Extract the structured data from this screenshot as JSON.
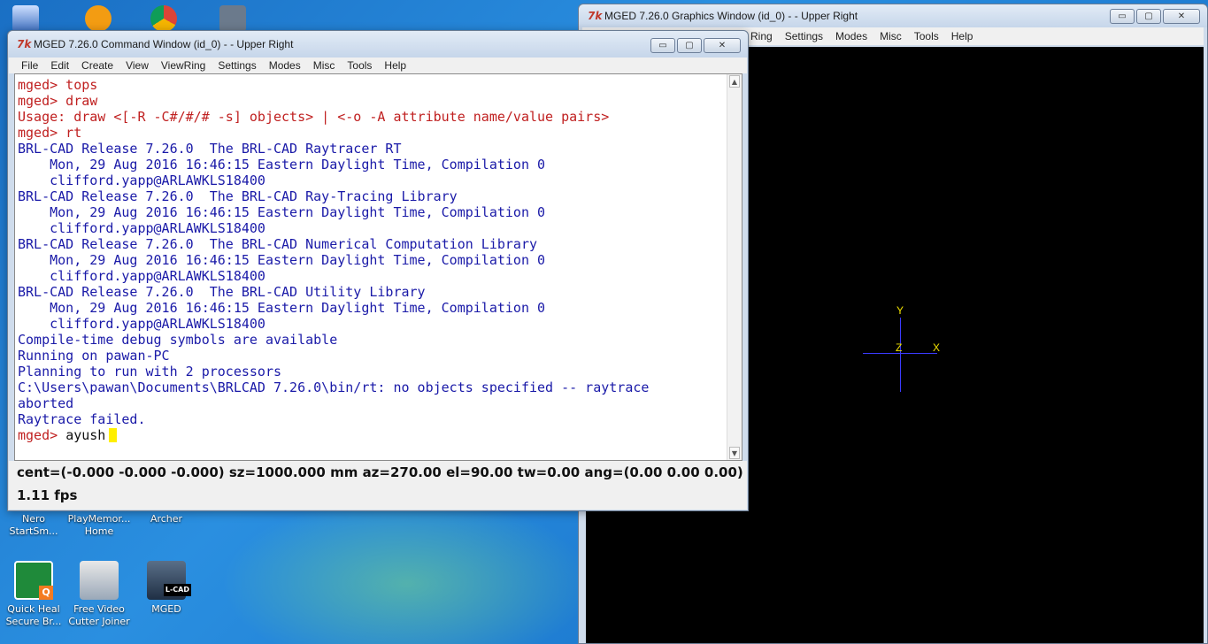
{
  "desktop": {
    "icons_top": [
      {
        "label": "Nero StartSm..."
      },
      {
        "label": "PlayMemor... Home"
      },
      {
        "label": "Archer"
      }
    ],
    "icons": [
      {
        "label_1": "Quick Heal",
        "label_2": "Secure Br...",
        "icon": "quickheal-icon"
      },
      {
        "label_1": "Free Video",
        "label_2": "Cutter Joiner",
        "icon": "video-cutter-icon"
      },
      {
        "label_1": "MGED",
        "label_2": "",
        "icon": "mged-icon"
      }
    ]
  },
  "graphics_window": {
    "title": "MGED 7.26.0 Graphics Window (id_0) -  - Upper Right",
    "menu": [
      "Ring",
      "Settings",
      "Modes",
      "Misc",
      "Tools",
      "Help"
    ],
    "axis_labels": {
      "x": "X",
      "y": "Y",
      "z": "Z"
    },
    "background": "#000000"
  },
  "command_window": {
    "title": "MGED 7.26.0 Command Window (id_0) -  - Upper Right",
    "menu": [
      "File",
      "Edit",
      "Create",
      "View",
      "ViewRing",
      "Settings",
      "Modes",
      "Misc",
      "Tools",
      "Help"
    ],
    "console": [
      {
        "type": "prompt",
        "text": "mged> tops"
      },
      {
        "type": "prompt",
        "text": "mged> draw"
      },
      {
        "type": "err",
        "text": "Usage: draw <[-R -C#/#/# -s] objects> | <-o -A attribute name/value pairs>"
      },
      {
        "type": "prompt",
        "text": "mged> rt"
      },
      {
        "type": "out",
        "text": "BRL-CAD Release 7.26.0  The BRL-CAD Raytracer RT"
      },
      {
        "type": "out",
        "text": "    Mon, 29 Aug 2016 16:46:15 Eastern Daylight Time, Compilation 0"
      },
      {
        "type": "out",
        "text": "    clifford.yapp@ARLAWKLS18400"
      },
      {
        "type": "out",
        "text": "BRL-CAD Release 7.26.0  The BRL-CAD Ray-Tracing Library"
      },
      {
        "type": "out",
        "text": "    Mon, 29 Aug 2016 16:46:15 Eastern Daylight Time, Compilation 0"
      },
      {
        "type": "out",
        "text": "    clifford.yapp@ARLAWKLS18400"
      },
      {
        "type": "out",
        "text": "BRL-CAD Release 7.26.0  The BRL-CAD Numerical Computation Library"
      },
      {
        "type": "out",
        "text": "    Mon, 29 Aug 2016 16:46:15 Eastern Daylight Time, Compilation 0"
      },
      {
        "type": "out",
        "text": "    clifford.yapp@ARLAWKLS18400"
      },
      {
        "type": "out",
        "text": "BRL-CAD Release 7.26.0  The BRL-CAD Utility Library"
      },
      {
        "type": "out",
        "text": "    Mon, 29 Aug 2016 16:46:15 Eastern Daylight Time, Compilation 0"
      },
      {
        "type": "out",
        "text": "    clifford.yapp@ARLAWKLS18400"
      },
      {
        "type": "out",
        "text": ""
      },
      {
        "type": "out",
        "text": "Compile-time debug symbols are available"
      },
      {
        "type": "out",
        "text": "Running on pawan-PC"
      },
      {
        "type": "out",
        "text": "Planning to run with 2 processors"
      },
      {
        "type": "out",
        "text": "C:\\Users\\pawan\\Documents\\BRLCAD 7.26.0\\bin/rt: no objects specified -- raytrace"
      },
      {
        "type": "out",
        "text": "aborted"
      },
      {
        "type": "out",
        "text": "Raytrace failed."
      }
    ],
    "current_prompt": "mged>",
    "current_input": "ayush",
    "status_line": "cent=(-0.000 -0.000 -0.000) sz=1000.000  mm  az=270.00  el=90.00  tw=0.00  ang=(0.00 0.00 0.00)",
    "fps_line": "1.11 fps",
    "cursor_color": "#ffef00"
  },
  "window_buttons": {
    "minimize": "▭",
    "maximize": "▢",
    "close": "✕"
  }
}
